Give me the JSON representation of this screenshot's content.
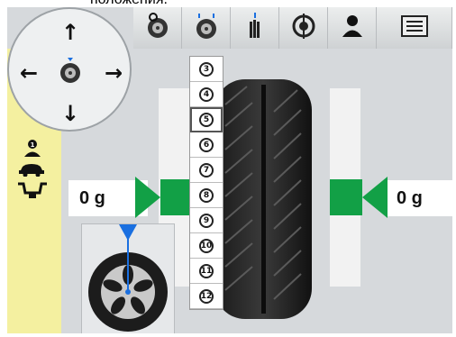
{
  "caption": "положения.",
  "toolbar": {
    "buttons": [
      {
        "icon": "wheel-spin-icon"
      },
      {
        "icon": "wheel-positions-icon"
      },
      {
        "icon": "balance-weights-icon"
      },
      {
        "icon": "wheel-target-icon"
      },
      {
        "icon": "operator-icon"
      },
      {
        "icon": "menu-list-icon"
      }
    ]
  },
  "navigation": {
    "up": "↑",
    "down": "↓",
    "left": "←",
    "right": "→"
  },
  "positions": {
    "items": [
      "3",
      "4",
      "5",
      "6",
      "7",
      "8",
      "9",
      "10",
      "11",
      "12"
    ],
    "selected": "5"
  },
  "weights": {
    "left": "0 g",
    "right": "0 g"
  },
  "colors": {
    "accent_green": "#12a046",
    "indicator_blue": "#1a6fe0",
    "side_strip": "#f4f0a0"
  }
}
